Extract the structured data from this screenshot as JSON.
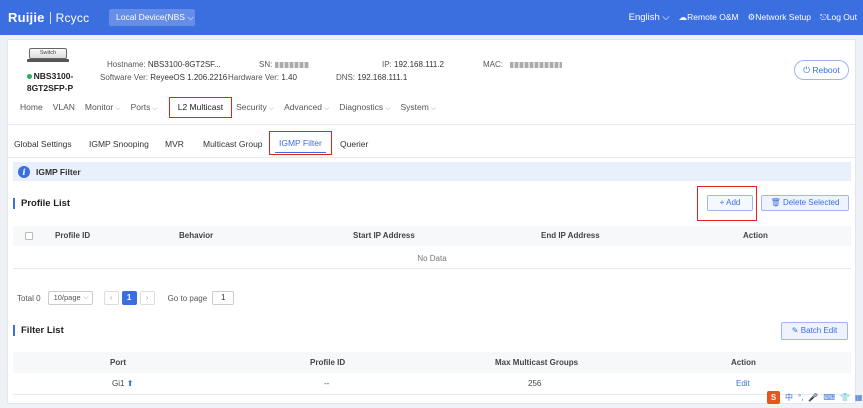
{
  "header": {
    "logo_brand": "Ruijie",
    "logo_sub": "Rcycc",
    "device_select": "Local Device(NBS",
    "language": "English",
    "remote": "Remote O&M",
    "network_setup": "Network Setup",
    "logout": "Log Out"
  },
  "device": {
    "icon_label": "Switch",
    "model_line1": "NBS3100-",
    "model_line2": "8GT2SFP-P",
    "hostname_label": "Hostname:",
    "hostname": "NBS3100-8GT2SF...",
    "software_label": "Software Ver:",
    "software": "ReyeeOS 1.206.2216",
    "sn_label": "SN:",
    "hardware_label": "Hardware Ver:",
    "hardware": "1.40",
    "ip_label": "IP:",
    "ip": "192.168.111.2",
    "dns_label": "DNS:",
    "dns": "192.168.111.1",
    "mac_label": "MAC:",
    "reboot": "Reboot"
  },
  "nav": {
    "home": "Home",
    "vlan": "VLAN",
    "monitor": "Monitor",
    "ports": "Ports",
    "l2multicast": "L2 Multicast",
    "security": "Security",
    "advanced": "Advanced",
    "diagnostics": "Diagnostics",
    "system": "System"
  },
  "subtabs": {
    "global": "Global Settings",
    "snooping": "IGMP Snooping",
    "mvr": "MVR",
    "group": "Multicast Group",
    "filter": "IGMP Filter",
    "querier": "Querier"
  },
  "infobar": "IGMP Filter",
  "profile": {
    "title": "Profile List",
    "add": "Add",
    "delete_selected": "Delete Selected",
    "columns": {
      "profile_id": "Profile ID",
      "behavior": "Behavior",
      "start_ip": "Start IP Address",
      "end_ip": "End IP Address",
      "action": "Action"
    },
    "no_data": "No Data"
  },
  "pagination": {
    "total": "Total 0",
    "per_page": "10/page",
    "current": "1",
    "goto_label": "Go to page",
    "goto_value": "1"
  },
  "filter": {
    "title": "Filter List",
    "batch_edit": "Batch Edit",
    "columns": {
      "port": "Port",
      "profile_id": "Profile ID",
      "max_groups": "Max Multicast Groups",
      "action": "Action"
    },
    "rows": [
      {
        "port": "Gi1",
        "profile_id": "--",
        "max_groups": "256",
        "action": "Edit"
      }
    ]
  },
  "tray": {
    "s": "S",
    "zh": "中"
  }
}
